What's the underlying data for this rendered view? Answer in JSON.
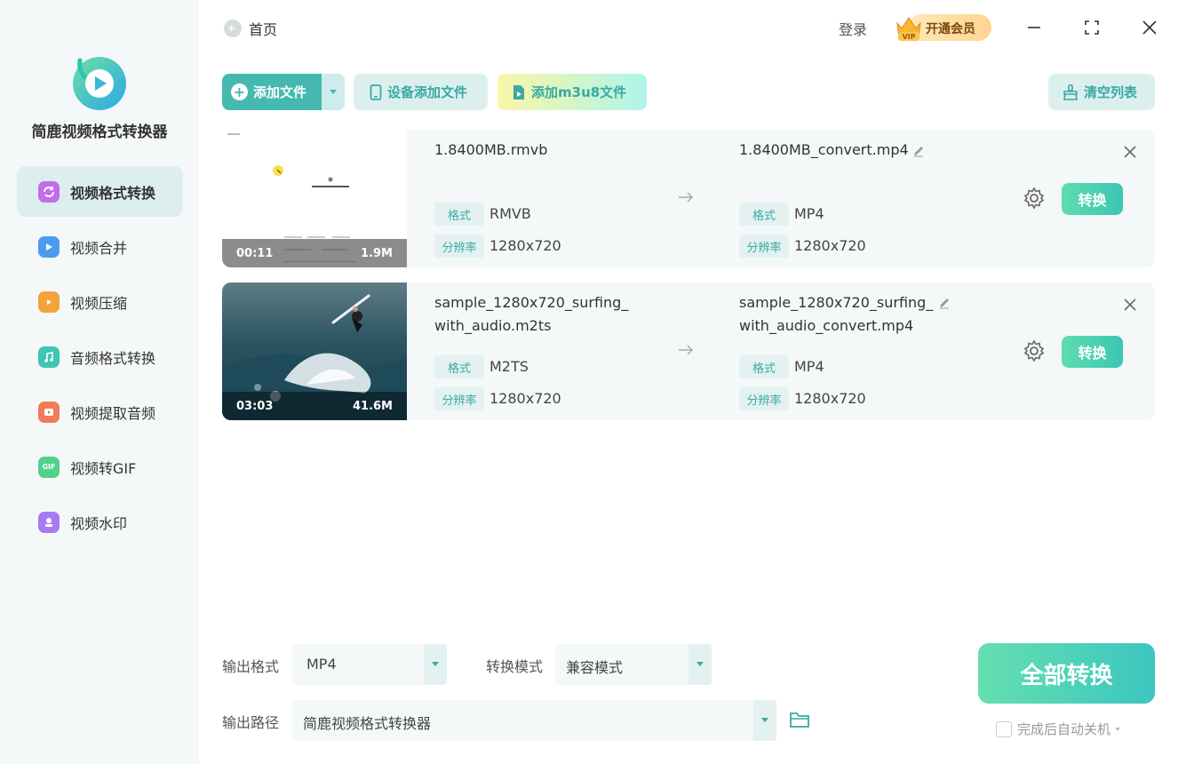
{
  "app": {
    "title": "简鹿视频格式转换器"
  },
  "sidebar": {
    "items": [
      {
        "label": "视频格式转换",
        "icon": "convert-icon",
        "color": "#c46de8",
        "active": true
      },
      {
        "label": "视频合并",
        "icon": "merge-icon",
        "color": "#4a9cf0",
        "active": false
      },
      {
        "label": "视频压缩",
        "icon": "compress-icon",
        "color": "#f3a33c",
        "active": false
      },
      {
        "label": "音频格式转换",
        "icon": "music-icon",
        "color": "#3cc6b4",
        "active": false
      },
      {
        "label": "视频提取音频",
        "icon": "extract-audio-icon",
        "color": "#f07b5b",
        "active": false
      },
      {
        "label": "视频转GIF",
        "icon": "gif-icon",
        "color": "#4fd28a",
        "active": false
      },
      {
        "label": "视频水印",
        "icon": "watermark-icon",
        "color": "#a77bf0",
        "active": false
      }
    ]
  },
  "topbar": {
    "home_label": "首页",
    "login_label": "登录",
    "vip_label": "开通会员",
    "vip_badge": "VIP"
  },
  "toolbar": {
    "add_file_label": "添加文件",
    "device_add_label": "设备添加文件",
    "add_m3u8_label": "添加m3u8文件",
    "clear_list_label": "清空列表"
  },
  "files": [
    {
      "duration": "00:11",
      "size": "1.9M",
      "source_name": "1.8400MB.rmvb",
      "source_format": "RMVB",
      "source_resolution": "1280x720",
      "output_name": "1.8400MB_convert.mp4",
      "output_format": "MP4",
      "output_resolution": "1280x720",
      "convert_label": "转换"
    },
    {
      "duration": "03:03",
      "size": "41.6M",
      "source_name": "sample_1280x720_surfing_with_audio.m2ts",
      "source_format": "M2TS",
      "source_resolution": "1280x720",
      "output_name": "sample_1280x720_surfing_with_audio_convert.mp4",
      "output_format": "MP4",
      "output_resolution": "1280x720",
      "convert_label": "转换"
    }
  ],
  "labels": {
    "format": "格式",
    "resolution": "分辨率"
  },
  "bottom": {
    "output_format_label": "输出格式",
    "output_format_value": "MP4",
    "convert_mode_label": "转换模式",
    "convert_mode_value": "兼容模式",
    "output_path_label": "输出路径",
    "output_path_value": "简鹿视频格式转换器",
    "convert_all_label": "全部转换",
    "auto_shutdown_label": "完成后自动关机"
  },
  "colors": {
    "accent": "#45b9b0",
    "accent_light": "#dcefef",
    "sidebar_bg": "#f5f8f8"
  }
}
